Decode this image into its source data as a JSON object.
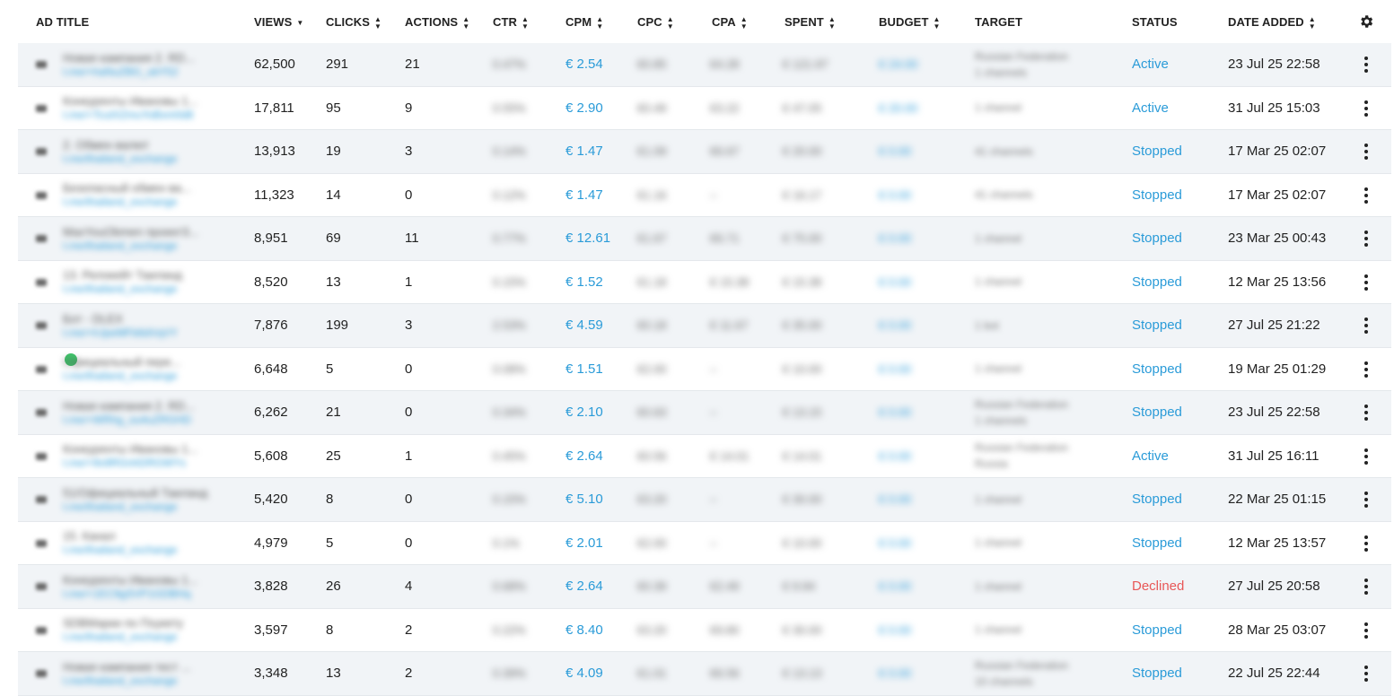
{
  "columns": {
    "ad_title": "AD TITLE",
    "views": "VIEWS",
    "clicks": "CLICKS",
    "actions": "ACTIONS",
    "ctr": "CTR",
    "cpm": "CPM",
    "cpc": "CPC",
    "cpa": "CPA",
    "spent": "SPENT",
    "budget": "BUDGET",
    "target": "TARGET",
    "status": "STATUS",
    "date_added": "DATE ADDED"
  },
  "icons": {
    "settings": "gear-icon",
    "row_menu": "kebab-menu-icon",
    "sort": "sort-arrows-icon",
    "sort_desc": "sort-desc-icon"
  },
  "colors": {
    "link": "#2a9bd8",
    "declined": "#e85757",
    "row_alt": "#f1f4f7"
  },
  "rows": [
    {
      "t1": "Новая кампания 2. RD...",
      "t2": "t.me/+haNuZBG_ubY52",
      "views": "62,500",
      "clicks": "291",
      "actions": "21",
      "ctr": "0.47%",
      "cpm": "€ 2.54",
      "cpc": "€0.85",
      "cpa": "€4.28",
      "spent": "€ 121.97",
      "budget": "€ 24.00",
      "target": [
        "Russian Federation",
        "1 channels"
      ],
      "status": "Active",
      "date": "23 Jul 25 22:58",
      "stype": "active"
    },
    {
      "t1": "Конкуренты Ивановы 1...",
      "t2": "t.me/+TcutXZmuYoBxm0d8",
      "views": "17,811",
      "clicks": "95",
      "actions": "9",
      "ctr": "0.55%",
      "cpm": "€ 2.90",
      "cpc": "€0.49",
      "cpa": "€3.22",
      "spent": "€ 47.05",
      "budget": "€ 20.00",
      "target": [
        "1 channel"
      ],
      "status": "Active",
      "date": "31 Jul 25 15:03",
      "stype": "active"
    },
    {
      "t1": "2. Обмен валют",
      "t2": "t.me/thailand_exchange",
      "views": "13,913",
      "clicks": "19",
      "actions": "3",
      "ctr": "0.14%",
      "cpm": "€ 1.47",
      "cpc": "€1.09",
      "cpa": "€6.67",
      "spent": "€ 20.00",
      "budget": "€ 0.00",
      "target": [
        "41 channels"
      ],
      "status": "Stopped",
      "date": "17 Mar 25 02:07",
      "stype": "stopped"
    },
    {
      "t1": "Безопасный обмен ва...",
      "t2": "t.me/thailand_exchange",
      "views": "11,323",
      "clicks": "14",
      "actions": "0",
      "ctr": "0.12%",
      "cpm": "€ 1.47",
      "cpc": "€1.16",
      "cpa": "–",
      "spent": "€ 16.17",
      "budget": "€ 0.00",
      "target": [
        "41 channels"
      ],
      "status": "Stopped",
      "date": "17 Mar 25 02:07",
      "stype": "stopped"
    },
    {
      "t1": "MaxYouObmen проект3...",
      "t2": "t.me/thailand_exchange",
      "views": "8,951",
      "clicks": "69",
      "actions": "11",
      "ctr": "0.77%",
      "cpm": "€ 12.61",
      "cpc": "€1.67",
      "cpa": "€6.71",
      "spent": "€ 75.00",
      "budget": "€ 0.00",
      "target": [
        "1 channel"
      ],
      "status": "Stopped",
      "date": "23 Mar 25 00:43",
      "stype": "stopped"
    },
    {
      "t1": "13. Релокейт Таиланд",
      "t2": "t.me/thailand_exchange",
      "views": "8,520",
      "clicks": "13",
      "actions": "1",
      "ctr": "0.15%",
      "cpm": "€ 1.52",
      "cpc": "€1.18",
      "cpa": "€ 15.38",
      "spent": "€ 15.38",
      "budget": "€ 0.00",
      "target": [
        "1 channel"
      ],
      "status": "Stopped",
      "date": "12 Mar 25 13:56",
      "stype": "stopped"
    },
    {
      "t1": "Бот - DLEX",
      "t2": "t.me/+hJpeMFb6dVqVY",
      "views": "7,876",
      "clicks": "199",
      "actions": "3",
      "ctr": "2.53%",
      "cpm": "€ 4.59",
      "cpc": "€0.18",
      "cpa": "€ 11.67",
      "spent": "€ 35.00",
      "budget": "€ 0.00",
      "target": [
        "1 bot"
      ],
      "status": "Stopped",
      "date": "27 Jul 25 21:22",
      "stype": "stopped"
    },
    {
      "t1": "Официальный пере...",
      "t2": "t.me/thailand_exchange",
      "views": "6,648",
      "clicks": "5",
      "actions": "0",
      "ctr": "0.08%",
      "cpm": "€ 1.51",
      "cpc": "€2.00",
      "cpa": "–",
      "spent": "€ 10.00",
      "budget": "€ 0.00",
      "target": [
        "1 channel"
      ],
      "status": "Stopped",
      "date": "19 Mar 25 01:29",
      "stype": "stopped",
      "dot": true
    },
    {
      "t1": "Новая кампания 2. RD...",
      "t2": "t.me/+WRhg_ou4uZRGHD",
      "views": "6,262",
      "clicks": "21",
      "actions": "0",
      "ctr": "0.34%",
      "cpm": "€ 2.10",
      "cpc": "€0.63",
      "cpa": "–",
      "spent": "€ 13.15",
      "budget": "€ 0.00",
      "target": [
        "Russian Federation",
        "1 channels"
      ],
      "status": "Stopped",
      "date": "23 Jul 25 22:58",
      "stype": "stopped"
    },
    {
      "t1": "Конкуренты Ивановы 1...",
      "t2": "t.me/+9o9RGnhDRGWYs",
      "views": "5,608",
      "clicks": "25",
      "actions": "1",
      "ctr": "0.45%",
      "cpm": "€ 2.64",
      "cpc": "€0.56",
      "cpa": "€ 14.01",
      "spent": "€ 14.01",
      "budget": "€ 0.00",
      "target": [
        "Russian Federation",
        "Russia"
      ],
      "status": "Active",
      "date": "31 Jul 25 16:11",
      "stype": "active"
    },
    {
      "t1": "51/Официальный Таиланд",
      "t2": "t.me/thailand_exchange",
      "views": "5,420",
      "clicks": "8",
      "actions": "0",
      "ctr": "0.15%",
      "cpm": "€ 5.10",
      "cpc": "€3.20",
      "cpa": "–",
      "spent": "€ 30.00",
      "budget": "€ 0.00",
      "target": [
        "1 channel"
      ],
      "status": "Stopped",
      "date": "22 Mar 25 01:15",
      "stype": "stopped"
    },
    {
      "t1": "15. Канал",
      "t2": "t.me/thailand_exchange",
      "views": "4,979",
      "clicks": "5",
      "actions": "0",
      "ctr": "0.1%",
      "cpm": "€ 2.01",
      "cpc": "€2.00",
      "cpa": "–",
      "spent": "€ 10.00",
      "budget": "€ 0.00",
      "target": [
        "1 channel"
      ],
      "status": "Stopped",
      "date": "12 Mar 25 13:57",
      "stype": "stopped"
    },
    {
      "t1": "Конкуренты Ивановы 1...",
      "t2": "t.me/+1EC9gSVP1GDBHq",
      "views": "3,828",
      "clicks": "26",
      "actions": "4",
      "ctr": "0.68%",
      "cpm": "€ 2.64",
      "cpc": "€0.39",
      "cpa": "€2.49",
      "spent": "€ 9.94",
      "budget": "€ 0.00",
      "target": [
        "1 channel"
      ],
      "status": "Declined",
      "date": "27 Jul 25 20:58",
      "stype": "declined"
    },
    {
      "t1": "SDBМарки по Пхукету",
      "t2": "t.me/thailand_exchange",
      "views": "3,597",
      "clicks": "8",
      "actions": "2",
      "ctr": "0.22%",
      "cpm": "€ 8.40",
      "cpc": "€3.20",
      "cpa": "€9.80",
      "spent": "€ 30.00",
      "budget": "€ 0.00",
      "target": [
        "1 channel"
      ],
      "status": "Stopped",
      "date": "28 Mar 25 03:07",
      "stype": "stopped"
    },
    {
      "t1": "Новая кампания тест ...",
      "t2": "t.me/thailand_exchange",
      "views": "3,348",
      "clicks": "13",
      "actions": "2",
      "ctr": "0.39%",
      "cpm": "€ 4.09",
      "cpc": "€1.01",
      "cpa": "€6.56",
      "spent": "€ 13.13",
      "budget": "€ 0.00",
      "target": [
        "Russian Federation",
        "10 channels"
      ],
      "status": "Stopped",
      "date": "22 Jul 25 22:44",
      "stype": "stopped"
    }
  ]
}
